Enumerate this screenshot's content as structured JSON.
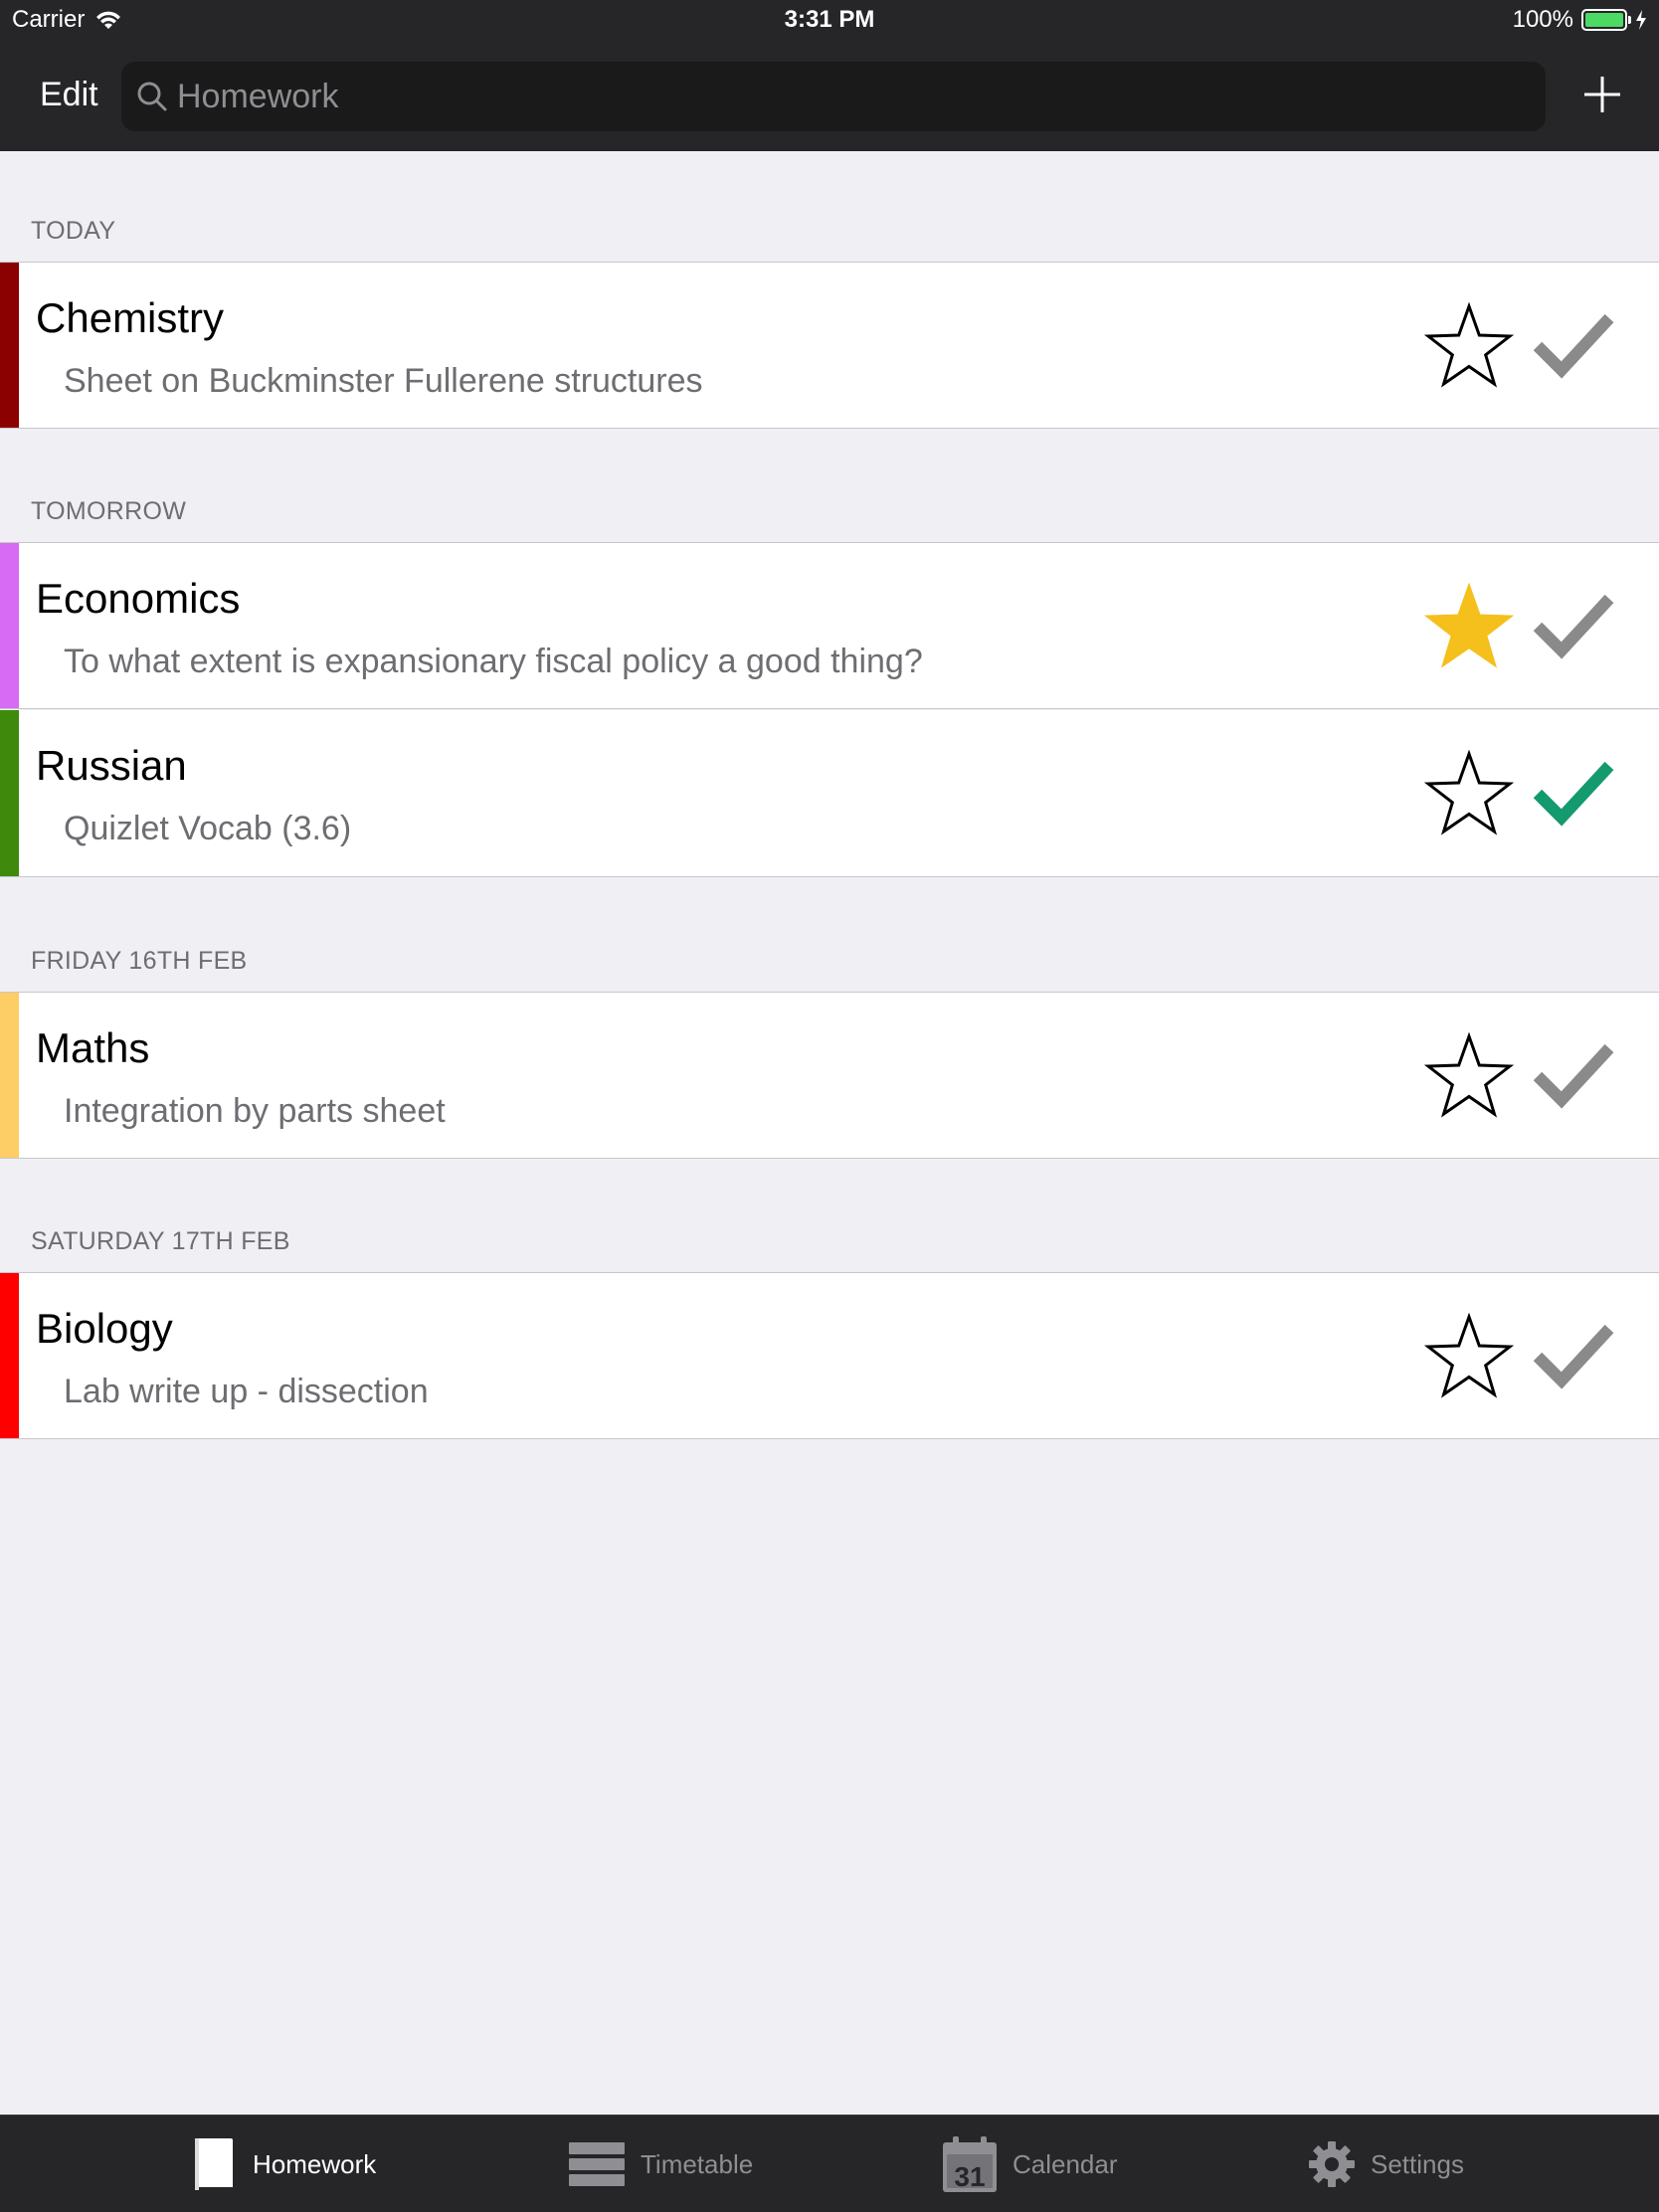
{
  "status_bar": {
    "carrier": "Carrier",
    "time": "3:31 PM",
    "battery": "100%"
  },
  "nav_bar": {
    "edit_label": "Edit",
    "search_placeholder": "Homework"
  },
  "sections": [
    {
      "header": "TODAY",
      "items": [
        {
          "subject": "Chemistry",
          "description": "Sheet on Buckminster Fullerene structures",
          "color": "#8b0000",
          "starred": false,
          "done": false
        }
      ]
    },
    {
      "header": "TOMORROW",
      "items": [
        {
          "subject": "Economics",
          "description": "To what extent is expansionary fiscal policy a good thing?",
          "color": "#d76bf3",
          "starred": true,
          "done": false
        },
        {
          "subject": "Russian",
          "description": "Quizlet Vocab (3.6)",
          "color": "#3f8a0c",
          "starred": false,
          "done": true
        }
      ]
    },
    {
      "header": "FRIDAY 16TH FEB",
      "items": [
        {
          "subject": "Maths",
          "description": "Integration by parts sheet",
          "color": "#fdcd66",
          "starred": false,
          "done": false
        }
      ]
    },
    {
      "header": "SATURDAY 17TH FEB",
      "items": [
        {
          "subject": "Biology",
          "description": "Lab write up - dissection",
          "color": "#ff0000",
          "starred": false,
          "done": false
        }
      ]
    }
  ],
  "tab_bar": {
    "tabs": [
      {
        "label": "Homework",
        "icon": "book-icon",
        "active": true
      },
      {
        "label": "Timetable",
        "icon": "list-icon",
        "active": false
      },
      {
        "label": "Calendar",
        "icon": "calendar-icon",
        "active": false
      },
      {
        "label": "Settings",
        "icon": "gear-icon",
        "active": false
      }
    ]
  },
  "colors": {
    "star_active": "#f5bf1c",
    "check_done": "#139a6e",
    "check_pending": "#8a8a8a"
  }
}
